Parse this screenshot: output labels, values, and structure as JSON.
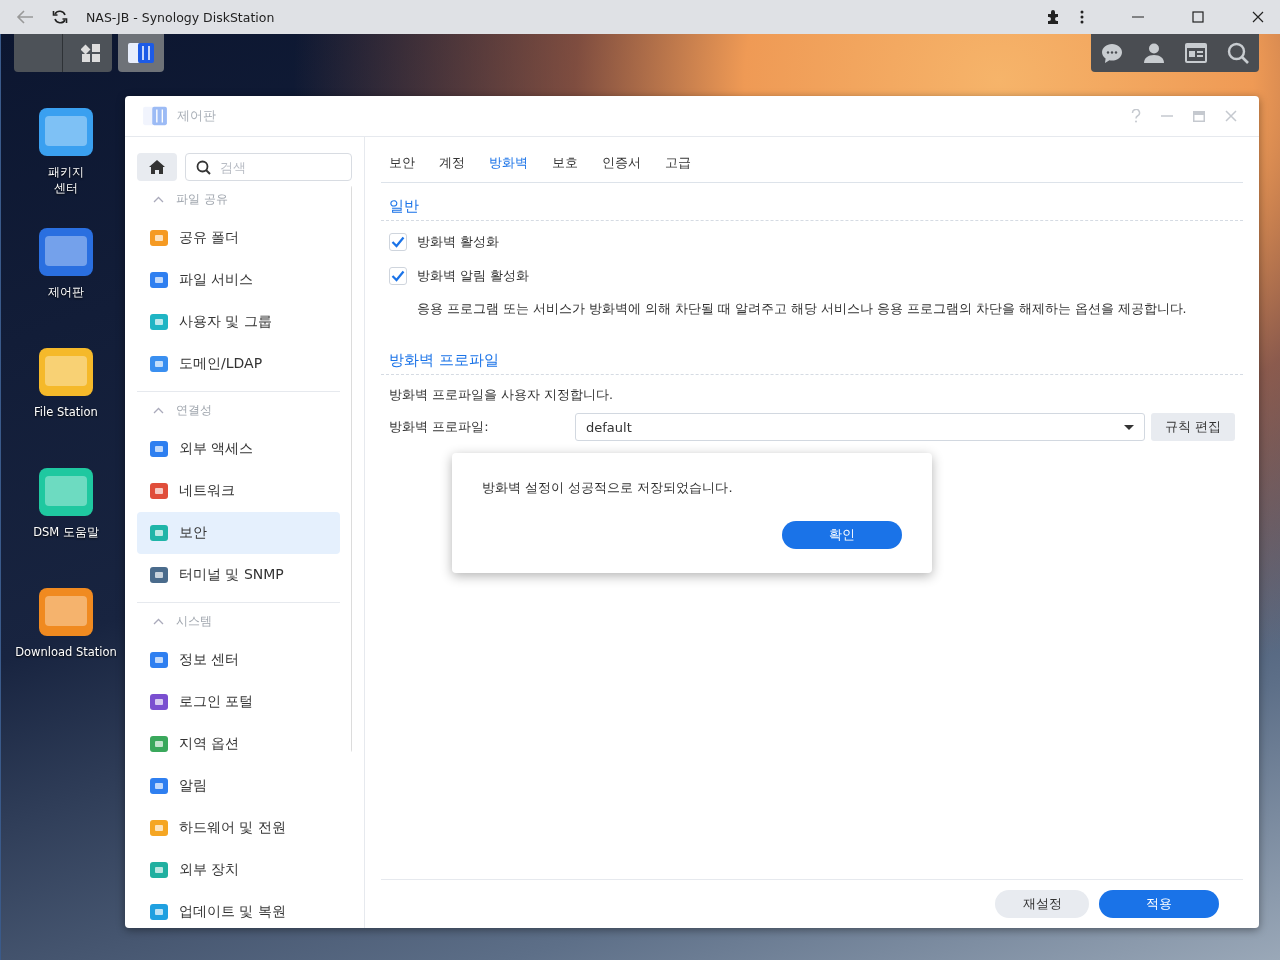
{
  "browser": {
    "title": "NAS-JB - Synology DiskStation",
    "back_disabled": true
  },
  "desktop_icons": [
    {
      "label": "패키지 센터"
    },
    {
      "label": "제어판"
    },
    {
      "label": "File Station"
    },
    {
      "label": "DSM 도움말"
    },
    {
      "label": "Download Station"
    }
  ],
  "window": {
    "title": "제어판",
    "sidebar": {
      "search": {
        "placeholder": "검색"
      },
      "groups": [
        {
          "label": "파일 공유",
          "expanded": true,
          "items": [
            {
              "label": "공유 폴더",
              "selected": false
            },
            {
              "label": "파일 서비스",
              "selected": false
            },
            {
              "label": "사용자 및 그룹",
              "selected": false
            },
            {
              "label": "도메인/LDAP",
              "selected": false
            }
          ]
        },
        {
          "label": "연결성",
          "expanded": true,
          "items": [
            {
              "label": "외부 액세스",
              "selected": false
            },
            {
              "label": "네트워크",
              "selected": false
            },
            {
              "label": "보안",
              "selected": true
            },
            {
              "label": "터미널 및 SNMP",
              "selected": false
            }
          ]
        },
        {
          "label": "시스템",
          "expanded": true,
          "items": [
            {
              "label": "정보 센터",
              "selected": false
            },
            {
              "label": "로그인 포털",
              "selected": false
            },
            {
              "label": "지역 옵션",
              "selected": false
            },
            {
              "label": "알림",
              "selected": false
            },
            {
              "label": "하드웨어 및 전원",
              "selected": false
            },
            {
              "label": "외부 장치",
              "selected": false
            },
            {
              "label": "업데이트 및 복원",
              "selected": false
            }
          ]
        }
      ]
    },
    "tabs": [
      {
        "label": "보안",
        "selected": false
      },
      {
        "label": "계정",
        "selected": false
      },
      {
        "label": "방화벽",
        "selected": true
      },
      {
        "label": "보호",
        "selected": false
      },
      {
        "label": "인증서",
        "selected": false
      },
      {
        "label": "고급",
        "selected": false
      }
    ],
    "general": {
      "title": "일반",
      "options": [
        {
          "label": "방화벽 활성화",
          "checked": true
        },
        {
          "label": "방화벽 알림 활성화",
          "checked": true
        }
      ],
      "description": "응용 프로그램 또는 서비스가 방화벽에 의해 차단될 때 알려주고 해당 서비스나 응용 프로그램의 차단을 해제하는 옵션을 제공합니다."
    },
    "profile": {
      "title": "방화벽 프로파일",
      "description": "방화벽 프로파일을 사용자 지정합니다.",
      "label": "방화벽 프로파일:",
      "value": "default",
      "button": "규칙 편집"
    },
    "buttons": [
      {
        "label": "재설정",
        "kind": "secondary"
      },
      {
        "label": "적용",
        "kind": "primary"
      }
    ]
  },
  "dialog": {
    "message": "방화벽 설정이 성공적으로 저장되었습니다.",
    "button": "확인"
  }
}
